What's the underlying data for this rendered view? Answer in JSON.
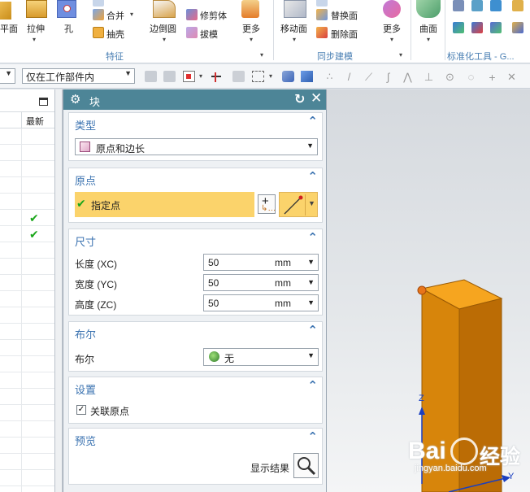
{
  "ribbon": {
    "plane_label": "平面",
    "extrude_label": "拉伸",
    "hole_label": "孔",
    "unite_label": "合并",
    "shell_label": "抽壳",
    "edge_blend_label": "边倒圆",
    "trim_body_label": "修剪体",
    "draft_label": "拔模",
    "more_label_1": "更多",
    "feature_group_label": "特征",
    "move_face_label": "移动面",
    "replace_face_label": "替换面",
    "delete_face_label": "删除面",
    "more_label_2": "更多",
    "surface_label": "曲面",
    "sync_group_label": "同步建模",
    "standard_tools_label": "标准化工具 - G..."
  },
  "toolbar2": {
    "scope_select": "仅在工作部件内"
  },
  "navigator": {
    "column_latest": "最新",
    "rows": [
      {
        "check": ""
      },
      {
        "check": ""
      },
      {
        "check": ""
      },
      {
        "check": ""
      },
      {
        "check": ""
      },
      {
        "check": "✔"
      },
      {
        "check": "✔"
      },
      {
        "check": ""
      },
      {
        "check": ""
      },
      {
        "check": ""
      },
      {
        "check": ""
      },
      {
        "check": ""
      },
      {
        "check": ""
      },
      {
        "check": ""
      },
      {
        "check": ""
      },
      {
        "check": ""
      },
      {
        "check": ""
      },
      {
        "check": ""
      },
      {
        "check": ""
      },
      {
        "check": ""
      },
      {
        "check": ""
      },
      {
        "check": ""
      },
      {
        "check": ""
      }
    ]
  },
  "dialog": {
    "title": "块",
    "type_section": {
      "title": "类型",
      "value": "原点和边长"
    },
    "origin_section": {
      "title": "原点",
      "specify_point": "指定点"
    },
    "dimensions_section": {
      "title": "尺寸",
      "length_label": "长度 (XC)",
      "length_value": "50",
      "width_label": "宽度 (YC)",
      "width_value": "50",
      "height_label": "高度 (ZC)",
      "height_value": "50",
      "unit": "mm"
    },
    "boolean_section": {
      "title": "布尔",
      "label": "布尔",
      "value": "无"
    },
    "settings_section": {
      "title": "设置",
      "associative_origin": "关联原点",
      "associative_checked": true
    },
    "preview_section": {
      "title": "预览",
      "show_result": "显示结果"
    }
  },
  "viewport": {
    "axis_z": "Z",
    "axis_y": "Y",
    "watermark_brand": "Bai",
    "watermark_cn": "经验",
    "watermark_url": "jingyan.baidu.com"
  },
  "colors": {
    "dialog_title_bg": "#4d8597",
    "section_title": "#3a72b0",
    "specify_point_bg": "#fbd36b",
    "check_green": "#1aa61a",
    "block_front": "#d7850b",
    "block_side": "#bb6c05",
    "block_top": "#f6a51f"
  }
}
